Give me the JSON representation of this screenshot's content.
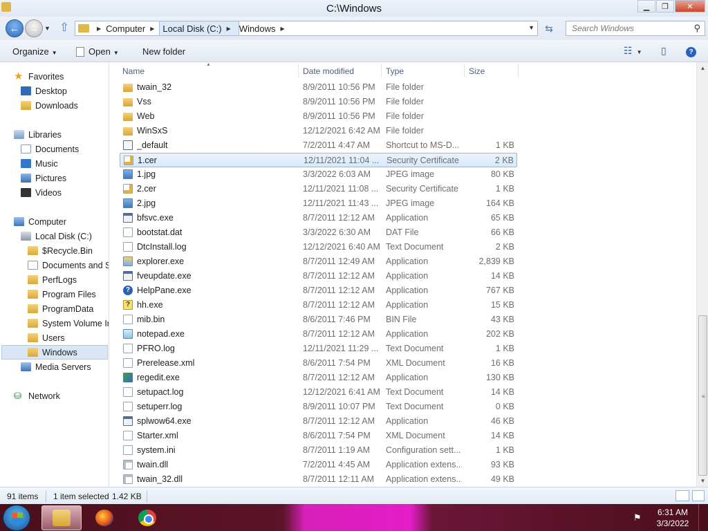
{
  "window": {
    "title": "C:\\Windows",
    "minimize": "▁",
    "maximize": "❐",
    "close": "✕"
  },
  "nav": {
    "back_icon": "arrow-left-icon",
    "forward_icon": "arrow-right-icon",
    "breadcrumbs": [
      "Computer",
      "Local Disk (C:)",
      "Windows"
    ],
    "search_placeholder": "Search Windows"
  },
  "toolbar": {
    "organize": "Organize",
    "open": "Open",
    "new_folder": "New folder"
  },
  "sidebar": {
    "favorites": {
      "label": "Favorites",
      "items": [
        "Desktop",
        "Downloads"
      ]
    },
    "libraries": {
      "label": "Libraries",
      "items": [
        "Documents",
        "Music",
        "Pictures",
        "Videos"
      ]
    },
    "computer": {
      "label": "Computer",
      "disk": "Local Disk (C:)",
      "folders": [
        "$Recycle.Bin",
        "Documents and Se",
        "PerfLogs",
        "Program Files",
        "ProgramData",
        "System Volume In",
        "Users",
        "Windows"
      ],
      "media": "Media Servers"
    },
    "network": "Network"
  },
  "columns": {
    "name": "Name",
    "date": "Date modified",
    "type": "Type",
    "size": "Size"
  },
  "files": [
    {
      "name": "twain_32",
      "date": "8/9/2011 10:56 PM",
      "type": "File folder",
      "size": "",
      "icon": "folder"
    },
    {
      "name": "Vss",
      "date": "8/9/2011 10:56 PM",
      "type": "File folder",
      "size": "",
      "icon": "folder"
    },
    {
      "name": "Web",
      "date": "8/9/2011 10:56 PM",
      "type": "File folder",
      "size": "",
      "icon": "folder"
    },
    {
      "name": "WinSxS",
      "date": "12/12/2021 6:42 AM",
      "type": "File folder",
      "size": "",
      "icon": "folder"
    },
    {
      "name": "_default",
      "date": "7/2/2011 4:47 AM",
      "type": "Shortcut to MS-D...",
      "size": "1 KB",
      "icon": "short"
    },
    {
      "name": "1.cer",
      "date": "12/11/2021 11:04 ...",
      "type": "Security Certificate",
      "size": "2 KB",
      "icon": "cert",
      "selected": true
    },
    {
      "name": "1.jpg",
      "date": "3/3/2022 6:03 AM",
      "type": "JPEG image",
      "size": "80 KB",
      "icon": "img"
    },
    {
      "name": "2.cer",
      "date": "12/11/2021 11:08 ...",
      "type": "Security Certificate",
      "size": "1 KB",
      "icon": "cert"
    },
    {
      "name": "2.jpg",
      "date": "12/11/2021 11:43 ...",
      "type": "JPEG image",
      "size": "164 KB",
      "icon": "img"
    },
    {
      "name": "bfsvc.exe",
      "date": "8/7/2011 12:12 AM",
      "type": "Application",
      "size": "65 KB",
      "icon": "app"
    },
    {
      "name": "bootstat.dat",
      "date": "3/3/2022 6:30 AM",
      "type": "DAT File",
      "size": "66 KB",
      "icon": "file"
    },
    {
      "name": "DtcInstall.log",
      "date": "12/12/2021 6:40 AM",
      "type": "Text Document",
      "size": "2 KB",
      "icon": "file"
    },
    {
      "name": "explorer.exe",
      "date": "8/7/2011 12:49 AM",
      "type": "Application",
      "size": "2,839 KB",
      "icon": "explorer"
    },
    {
      "name": "fveupdate.exe",
      "date": "8/7/2011 12:12 AM",
      "type": "Application",
      "size": "14 KB",
      "icon": "app"
    },
    {
      "name": "HelpPane.exe",
      "date": "8/7/2011 12:12 AM",
      "type": "Application",
      "size": "767 KB",
      "icon": "help"
    },
    {
      "name": "hh.exe",
      "date": "8/7/2011 12:12 AM",
      "type": "Application",
      "size": "15 KB",
      "icon": "hh"
    },
    {
      "name": "mib.bin",
      "date": "8/6/2011 7:46 PM",
      "type": "BIN File",
      "size": "43 KB",
      "icon": "file"
    },
    {
      "name": "notepad.exe",
      "date": "8/7/2011 12:12 AM",
      "type": "Application",
      "size": "202 KB",
      "icon": "notepad"
    },
    {
      "name": "PFRO.log",
      "date": "12/11/2021 11:29 ...",
      "type": "Text Document",
      "size": "1 KB",
      "icon": "file"
    },
    {
      "name": "Prerelease.xml",
      "date": "8/6/2011 7:54 PM",
      "type": "XML Document",
      "size": "16 KB",
      "icon": "file"
    },
    {
      "name": "regedit.exe",
      "date": "8/7/2011 12:12 AM",
      "type": "Application",
      "size": "130 KB",
      "icon": "reg"
    },
    {
      "name": "setupact.log",
      "date": "12/12/2021 6:41 AM",
      "type": "Text Document",
      "size": "14 KB",
      "icon": "file"
    },
    {
      "name": "setuperr.log",
      "date": "8/9/2011 10:07 PM",
      "type": "Text Document",
      "size": "0 KB",
      "icon": "file"
    },
    {
      "name": "splwow64.exe",
      "date": "8/7/2011 12:12 AM",
      "type": "Application",
      "size": "46 KB",
      "icon": "app"
    },
    {
      "name": "Starter.xml",
      "date": "8/6/2011 7:54 PM",
      "type": "XML Document",
      "size": "14 KB",
      "icon": "file"
    },
    {
      "name": "system.ini",
      "date": "8/7/2011 1:19 AM",
      "type": "Configuration sett...",
      "size": "1 KB",
      "icon": "file"
    },
    {
      "name": "twain.dll",
      "date": "7/2/2011 4:45 AM",
      "type": "Application extens...",
      "size": "93 KB",
      "icon": "dll"
    },
    {
      "name": "twain_32.dll",
      "date": "8/7/2011 12:11 AM",
      "type": "Application extens...",
      "size": "49 KB",
      "icon": "dll"
    }
  ],
  "status": {
    "count": "91 items",
    "selected": "1 item selected",
    "selected_size": "1.42 KB"
  },
  "taskbar": {
    "apps": [
      "windows-explorer",
      "firefox",
      "chrome"
    ],
    "time": "6:31 AM",
    "date": "3/3/2022"
  }
}
